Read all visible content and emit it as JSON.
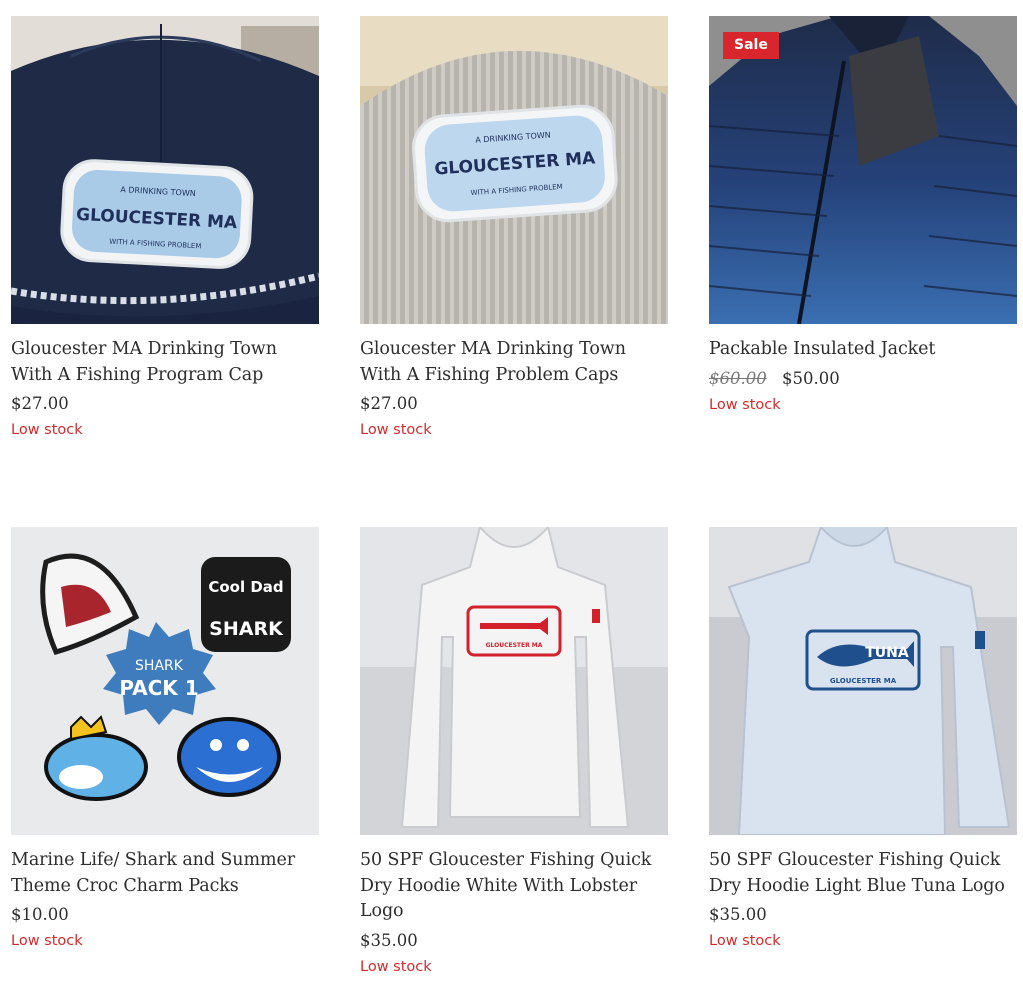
{
  "colors": {
    "sale": "#d9262c",
    "stock": "#d42a2a",
    "text": "#2d2d2d"
  },
  "products": [
    {
      "title": "Gloucester MA Drinking Town With A Fishing Program Cap",
      "price": "$27.00",
      "stock": "Low stock",
      "image_icon": "navy-cap-image",
      "patch": {
        "top": "A DRINKING TOWN",
        "main": "GLOUCESTER MA",
        "bottom": "WITH A FISHING PROBLEM"
      }
    },
    {
      "title": "Gloucester MA Drinking Town With A Fishing Problem Caps",
      "price": "$27.00",
      "stock": "Low stock",
      "image_icon": "grey-corduroy-cap-image",
      "patch": {
        "top": "A DRINKING TOWN",
        "main": "GLOUCESTER MA",
        "bottom": "WITH A FISHING PROBLEM"
      }
    },
    {
      "title": "Packable Insulated Jacket",
      "price_old": "$60.00",
      "price": "$50.00",
      "stock": "Low stock",
      "badge": "Sale",
      "image_icon": "puffer-jacket-image"
    },
    {
      "title": "Marine Life/ Shark and Summer Theme Croc Charm Packs",
      "price": "$10.00",
      "stock": "Low stock",
      "image_icon": "shark-charms-image",
      "art": {
        "badge_line1": "SHARK",
        "badge_line2": "PACK 1",
        "sticker_line1": "Cool Dad",
        "sticker_line2": "SHARK"
      }
    },
    {
      "title": "50 SPF Gloucester Fishing Quick Dry Hoodie White With Lobster Logo",
      "price": "$35.00",
      "stock": "Low stock",
      "image_icon": "white-hoodie-image",
      "art": {
        "logo_text": "GLOUCESTER MA"
      }
    },
    {
      "title": "50 SPF Gloucester Fishing Quick Dry Hoodie Light Blue Tuna Logo",
      "price": "$35.00",
      "stock": "Low stock",
      "image_icon": "light-blue-hoodie-image",
      "art": {
        "logo_word": "TUNA",
        "logo_text": "GLOUCESTER MA"
      }
    }
  ]
}
